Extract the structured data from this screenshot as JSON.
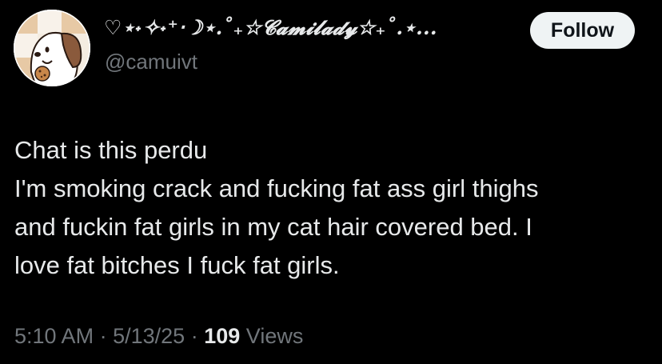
{
  "author": {
    "display_name": "♡⋆˖✧˖⁺‧☽⋆.˚₊☆𝓒𝓪𝓶𝓲𝓵𝓪𝓭𝔂☆₊˚.⋆...",
    "handle": "@camuivt",
    "avatar_icon": "dog-with-cookie-avatar-icon"
  },
  "actions": {
    "follow_label": "Follow"
  },
  "tweet": {
    "lines": [
      "Chat is this perdu",
      "I'm smoking crack and fucking fat ass girl thighs",
      "and fuckin fat girls in my cat hair covered bed. I",
      "love fat bitches I fuck fat girls."
    ]
  },
  "meta": {
    "time": "5:10 AM",
    "date": "5/13/25",
    "separator": "·",
    "views_count": "109",
    "views_label": "Views"
  },
  "colors": {
    "background": "#000000",
    "primary_text": "#e7e9ea",
    "secondary_text": "#71767b",
    "follow_bg": "#eff3f4"
  }
}
